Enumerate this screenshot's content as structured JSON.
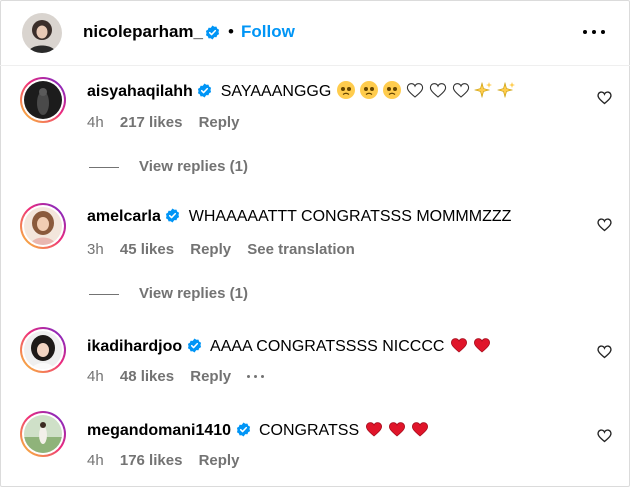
{
  "header": {
    "username": "nicoleparham_",
    "separator": "•",
    "follow_label": "Follow"
  },
  "comments": [
    {
      "username": "aisyahaqilahh",
      "text": "SAYAAANGGG",
      "time": "4h",
      "likes": "217 likes",
      "reply_label": "Reply",
      "view_replies": "View replies (1)"
    },
    {
      "username": "amelcarla",
      "text": "WHAAAAATTT CONGRATSSS MOMMMZZZ",
      "time": "3h",
      "likes": "45 likes",
      "reply_label": "Reply",
      "translation_label": "See translation",
      "view_replies": "View replies (1)"
    },
    {
      "username": "ikadihardjoo",
      "text": "AAAA CONGRATSSSS NICCCC",
      "time": "4h",
      "likes": "48 likes",
      "reply_label": "Reply"
    },
    {
      "username": "megandomani1410",
      "text": "CONGRATSS",
      "time": "4h",
      "likes": "176 likes",
      "reply_label": "Reply"
    }
  ],
  "colors": {
    "follow_blue": "#0095f6",
    "verified_blue": "#0095f6",
    "meta_gray": "#737373",
    "heart_red": "#e0152a"
  }
}
